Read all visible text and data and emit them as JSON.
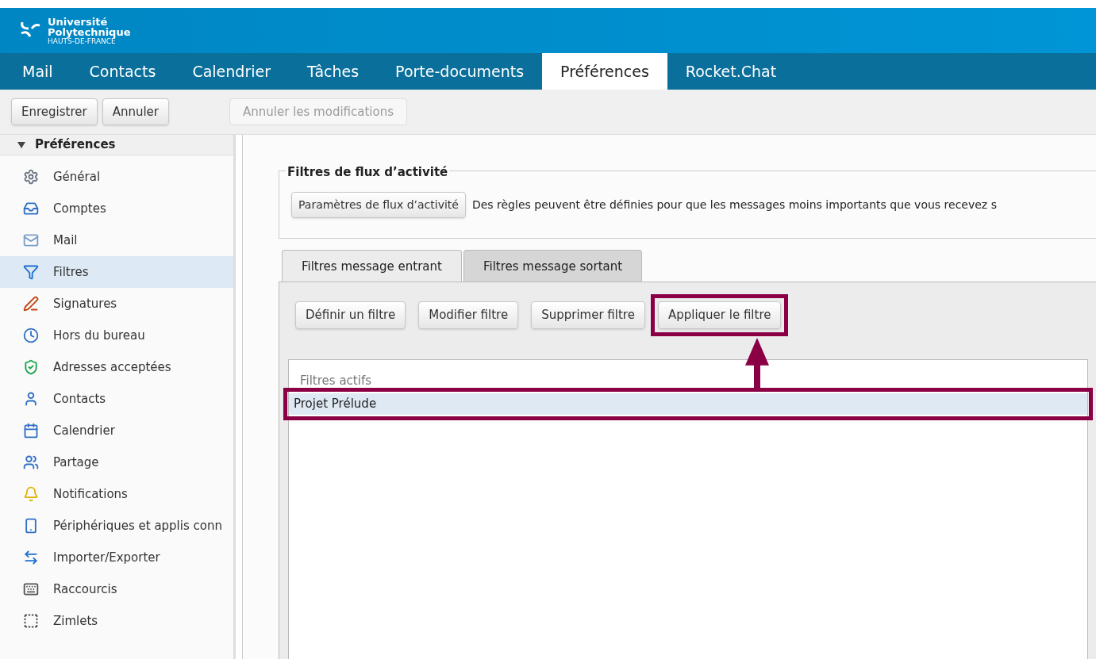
{
  "logo": {
    "line_1": "Université",
    "line_2": "Polytechnique",
    "line_3": "HAUTS-DE-FRANCE"
  },
  "app_tabs": [
    {
      "label": "Mail",
      "selected": false
    },
    {
      "label": "Contacts",
      "selected": false
    },
    {
      "label": "Calendrier",
      "selected": false
    },
    {
      "label": "Tâches",
      "selected": false
    },
    {
      "label": "Porte-documents",
      "selected": false
    },
    {
      "label": "Préférences",
      "selected": true
    },
    {
      "label": "Rocket.Chat",
      "selected": false
    }
  ],
  "toolbar": {
    "buttons": [
      {
        "label": "Enregistrer",
        "disabled": false
      },
      {
        "label": "Annuler",
        "disabled": false
      }
    ],
    "revert_button": {
      "label": "Annuler les modifications",
      "disabled": true
    }
  },
  "sidebar": {
    "header": "Préférences",
    "expanded": true,
    "items": [
      {
        "label": "Général",
        "selected": false
      },
      {
        "label": "Comptes",
        "selected": false
      },
      {
        "label": "Mail",
        "selected": false
      },
      {
        "label": "Filtres",
        "selected": true
      },
      {
        "label": "Signatures",
        "selected": false
      },
      {
        "label": "Hors du bureau",
        "selected": false
      },
      {
        "label": "Adresses acceptées",
        "selected": false
      },
      {
        "label": "Contacts",
        "selected": false
      },
      {
        "label": "Calendrier",
        "selected": false
      },
      {
        "label": "Partage",
        "selected": false
      },
      {
        "label": "Notifications",
        "selected": false
      },
      {
        "label": "Périphériques et applis conn",
        "selected": false
      },
      {
        "label": "Importer/Exporter",
        "selected": false
      },
      {
        "label": "Raccourcis",
        "selected": false
      },
      {
        "label": "Zimlets",
        "selected": false
      }
    ]
  },
  "activity_section": {
    "legend": "Filtres de flux d’activité",
    "button": "Paramètres de flux d’activité",
    "description": "Des règles peuvent être définies pour que les messages moins importants que vous recevez s"
  },
  "filter_tabs": [
    {
      "label": "Filtres message entrant",
      "selected": true
    },
    {
      "label": "Filtres message sortant",
      "selected": false
    }
  ],
  "filter_buttons": [
    {
      "label": "Définir un filtre",
      "highlighted": false
    },
    {
      "label": "Modifier filtre",
      "highlighted": false
    },
    {
      "label": "Supprimer filtre",
      "highlighted": false
    },
    {
      "label": "Appliquer le filtre",
      "highlighted": true
    }
  ],
  "active_filters": {
    "header": "Filtres actifs",
    "rows": [
      {
        "name": "Projet Prélude",
        "selected": true,
        "highlighted": true
      }
    ]
  }
}
